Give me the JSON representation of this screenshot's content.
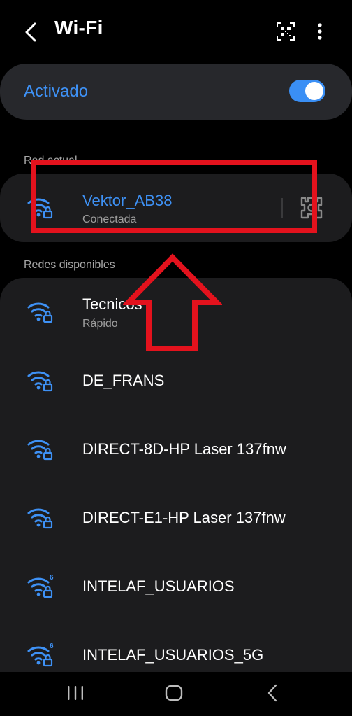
{
  "header": {
    "title": "Wi-Fi"
  },
  "wifi_toggle": {
    "label": "Activado",
    "on": true
  },
  "current_section": {
    "label": "Red actual"
  },
  "current_network": {
    "name": "Vektor_AB38",
    "status": "Conectada",
    "icon": "wifi-lock-icon"
  },
  "available_section": {
    "label": "Redes disponibles"
  },
  "available_networks": [
    {
      "name": "Tecnicos",
      "detail": "Rápido",
      "icon": "wifi-lock-icon"
    },
    {
      "name": "DE_FRANS",
      "icon": "wifi-lock-icon"
    },
    {
      "name": "DIRECT-8D-HP Laser 137fnw",
      "icon": "wifi-lock-icon"
    },
    {
      "name": "DIRECT-E1-HP Laser 137fnw",
      "icon": "wifi-lock-icon"
    },
    {
      "name": "INTELAF_USUARIOS",
      "icon": "wifi6-lock-icon",
      "badge": "6"
    },
    {
      "name": "INTELAF_USUARIOS_5G",
      "icon": "wifi6-lock-icon",
      "badge": "6"
    }
  ],
  "colors": {
    "accent": "#3e91f5",
    "annotation": "#e3121d",
    "card": "#1c1c1e",
    "toggle_card": "#27282c"
  }
}
